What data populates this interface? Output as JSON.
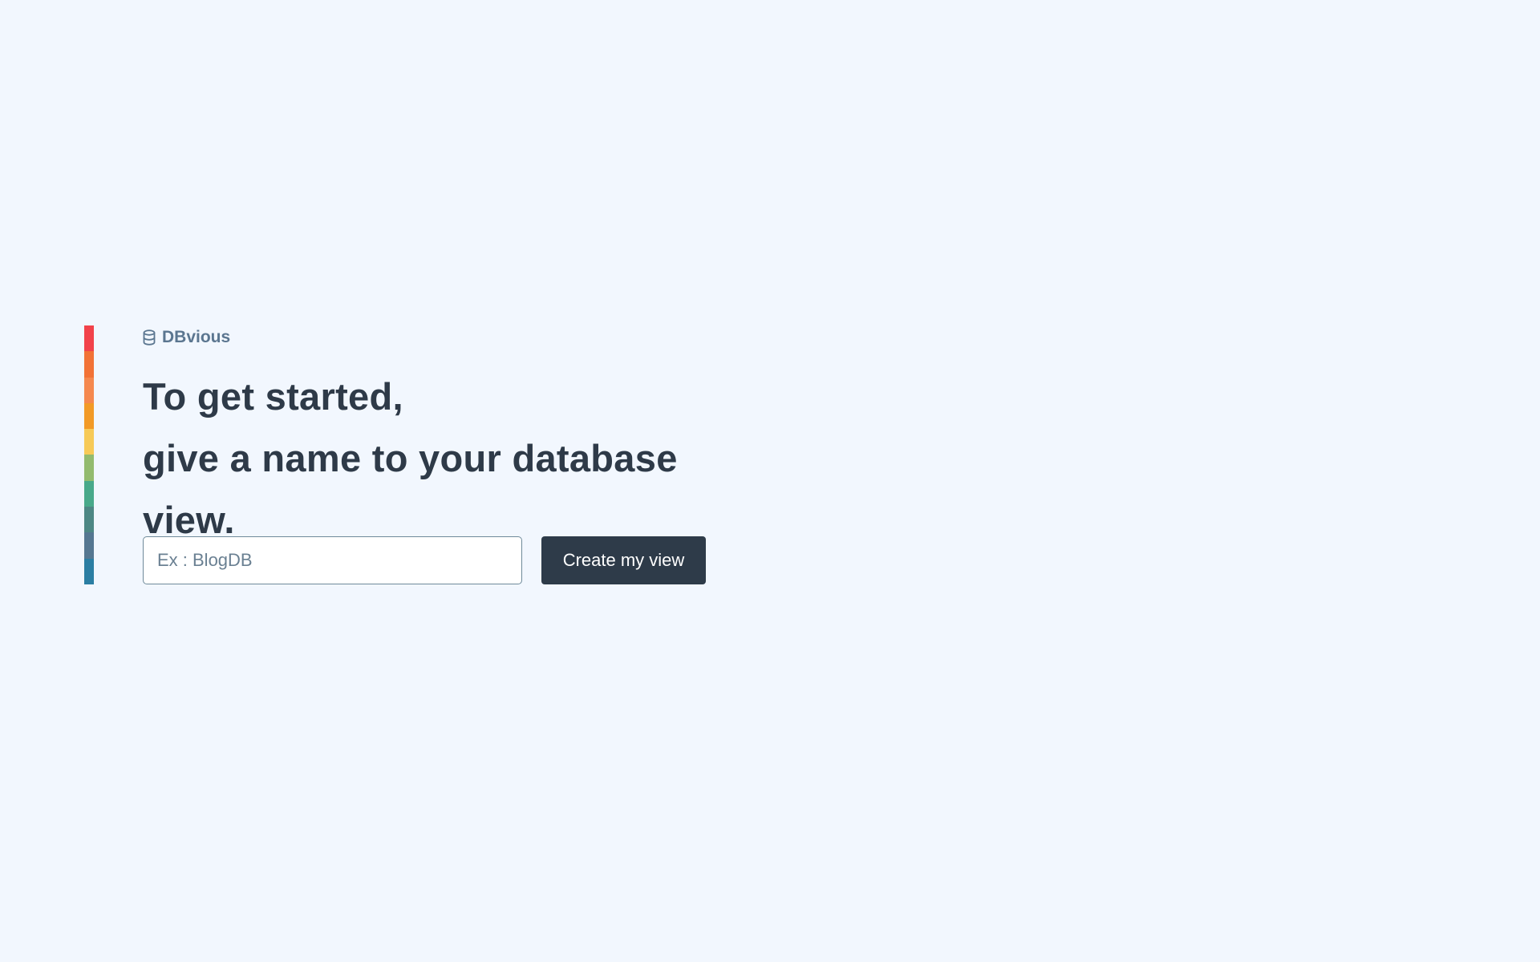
{
  "brand": {
    "name": "DBvious",
    "icon": "database-icon"
  },
  "headline": {
    "line1": "To get started,",
    "line2": "give a name to your database",
    "line3": "view."
  },
  "form": {
    "name_value": "",
    "name_placeholder": "Ex : BlogDB",
    "submit_label": "Create my view"
  },
  "accent_stripe_colors": [
    "#f2424a",
    "#f27236",
    "#f5884e",
    "#f29a26",
    "#f7ca57",
    "#93bb6e",
    "#48a98a",
    "#4d8784",
    "#557791",
    "#2b7ea3"
  ],
  "colors": {
    "background": "#f2f7fe",
    "text": "#2e3a48",
    "brand": "#5b7690",
    "button": "#2e3b49"
  }
}
